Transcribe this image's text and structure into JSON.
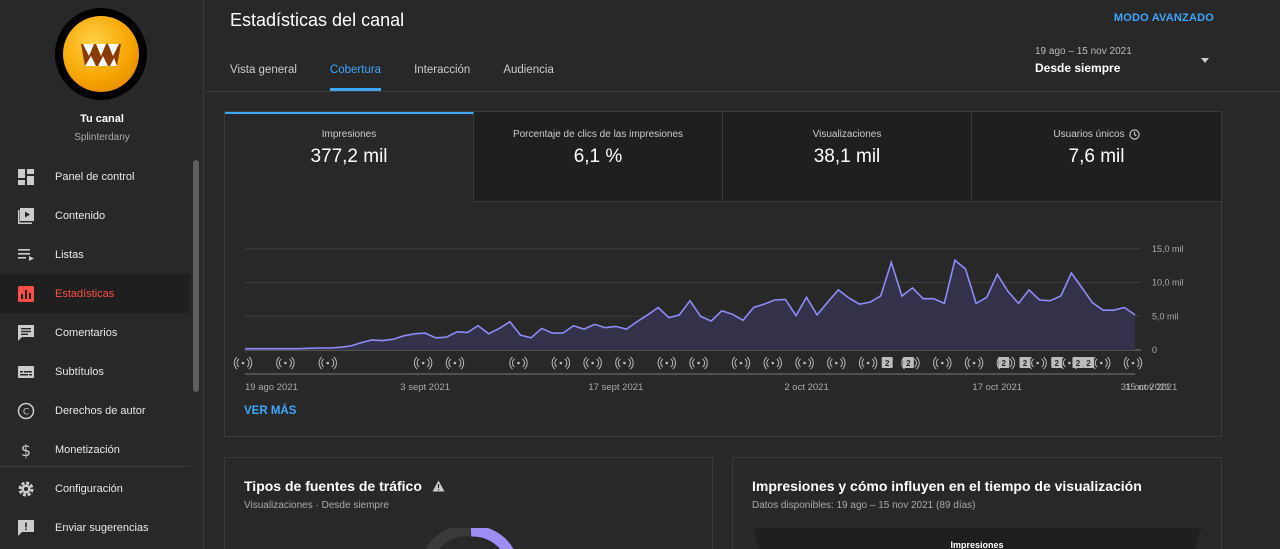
{
  "header": {
    "title": "Estadísticas del canal",
    "advanced_mode": "MODO AVANZADO",
    "tabs": [
      {
        "label": "Vista general"
      },
      {
        "label": "Cobertura"
      },
      {
        "label": "Interacción"
      },
      {
        "label": "Audiencia"
      }
    ],
    "active_tab": "Cobertura",
    "date_range": {
      "dates": "19 ago – 15 nov 2021",
      "value": "Desde siempre"
    }
  },
  "sidebar": {
    "channel_name": "Tu canal",
    "channel_handle": "Splinterdany",
    "items": [
      {
        "label": "Panel de control",
        "icon": "dashboard-icon"
      },
      {
        "label": "Contenido",
        "icon": "content-icon"
      },
      {
        "label": "Listas",
        "icon": "playlist-icon"
      },
      {
        "label": "Estadísticas",
        "icon": "analytics-icon",
        "active": true
      },
      {
        "label": "Comentarios",
        "icon": "comments-icon"
      },
      {
        "label": "Subtítulos",
        "icon": "subtitles-icon"
      },
      {
        "label": "Derechos de autor",
        "icon": "copyright-icon"
      },
      {
        "label": "Monetización",
        "icon": "dollar-icon"
      }
    ],
    "bottom_items": [
      {
        "label": "Configuración",
        "icon": "gear-icon"
      },
      {
        "label": "Enviar sugerencias",
        "icon": "feedback-icon"
      }
    ]
  },
  "metrics": [
    {
      "label": "Impresiones",
      "value": "377,2 mil",
      "active": true
    },
    {
      "label": "Porcentaje de clics de las impresiones",
      "value": "6,1 %"
    },
    {
      "label": "Visualizaciones",
      "value": "38,1 mil"
    },
    {
      "label": "Usuarios únicos",
      "value": "7,6 mil",
      "icon": "clock-icon"
    }
  ],
  "ver_mas": "VER MÁS",
  "traffic_card": {
    "title": "Tipos de fuentes de tráfico",
    "subtitle": "Visualizaciones · Desde siempre"
  },
  "impressions_card": {
    "title": "Impresiones y cómo influyen en el tiempo de visualización",
    "subtitle": "Datos disponibles: 19 ago – 15 nov 2021 (89 días)",
    "funnel_label": "Impresiones"
  },
  "colors": {
    "accent": "#3ea6ff",
    "active_nav": "#ff4e45",
    "line": "#8c8cf7"
  },
  "chart_data": {
    "type": "area",
    "series": [
      {
        "values": [
          200,
          200,
          200,
          200,
          200,
          200,
          250,
          300,
          300,
          400,
          600,
          1100,
          1500,
          1400,
          1600,
          2100,
          2400,
          2500,
          1800,
          1900,
          2700,
          2600,
          3600,
          2400,
          3200,
          4200,
          2200,
          1800,
          3200,
          2500,
          2500,
          3600,
          3100,
          3800,
          3300,
          3500,
          3100,
          4200,
          5200,
          6300,
          4800,
          5200,
          7300,
          5000,
          4300,
          5800,
          5300,
          4400,
          6300,
          6800,
          7400,
          7500,
          5100,
          7800,
          5200,
          7100,
          8900,
          7700,
          6800,
          7100,
          8000,
          13000,
          8000,
          9200,
          7600,
          7600,
          6900,
          13300,
          12000,
          6900,
          7800,
          11200,
          8700,
          6900,
          8900,
          7400,
          7300,
          8000,
          11400,
          9200,
          7000,
          5900,
          5900,
          6300,
          5200
        ]
      }
    ],
    "ylim": [
      0,
      16000
    ],
    "y_ticks": [
      "15,0 mil",
      "10,0 mil",
      "5,0 mil",
      "0"
    ],
    "y_tick_values": [
      15000,
      10000,
      5000,
      0
    ],
    "x_tick_labels": [
      "19 ago 2021",
      "3 sept 2021",
      "17 sept 2021",
      "2 oct 2021",
      "17 oct 2021",
      "31 oct 2021",
      "15 nov 2021"
    ],
    "markers_badge": "2"
  }
}
